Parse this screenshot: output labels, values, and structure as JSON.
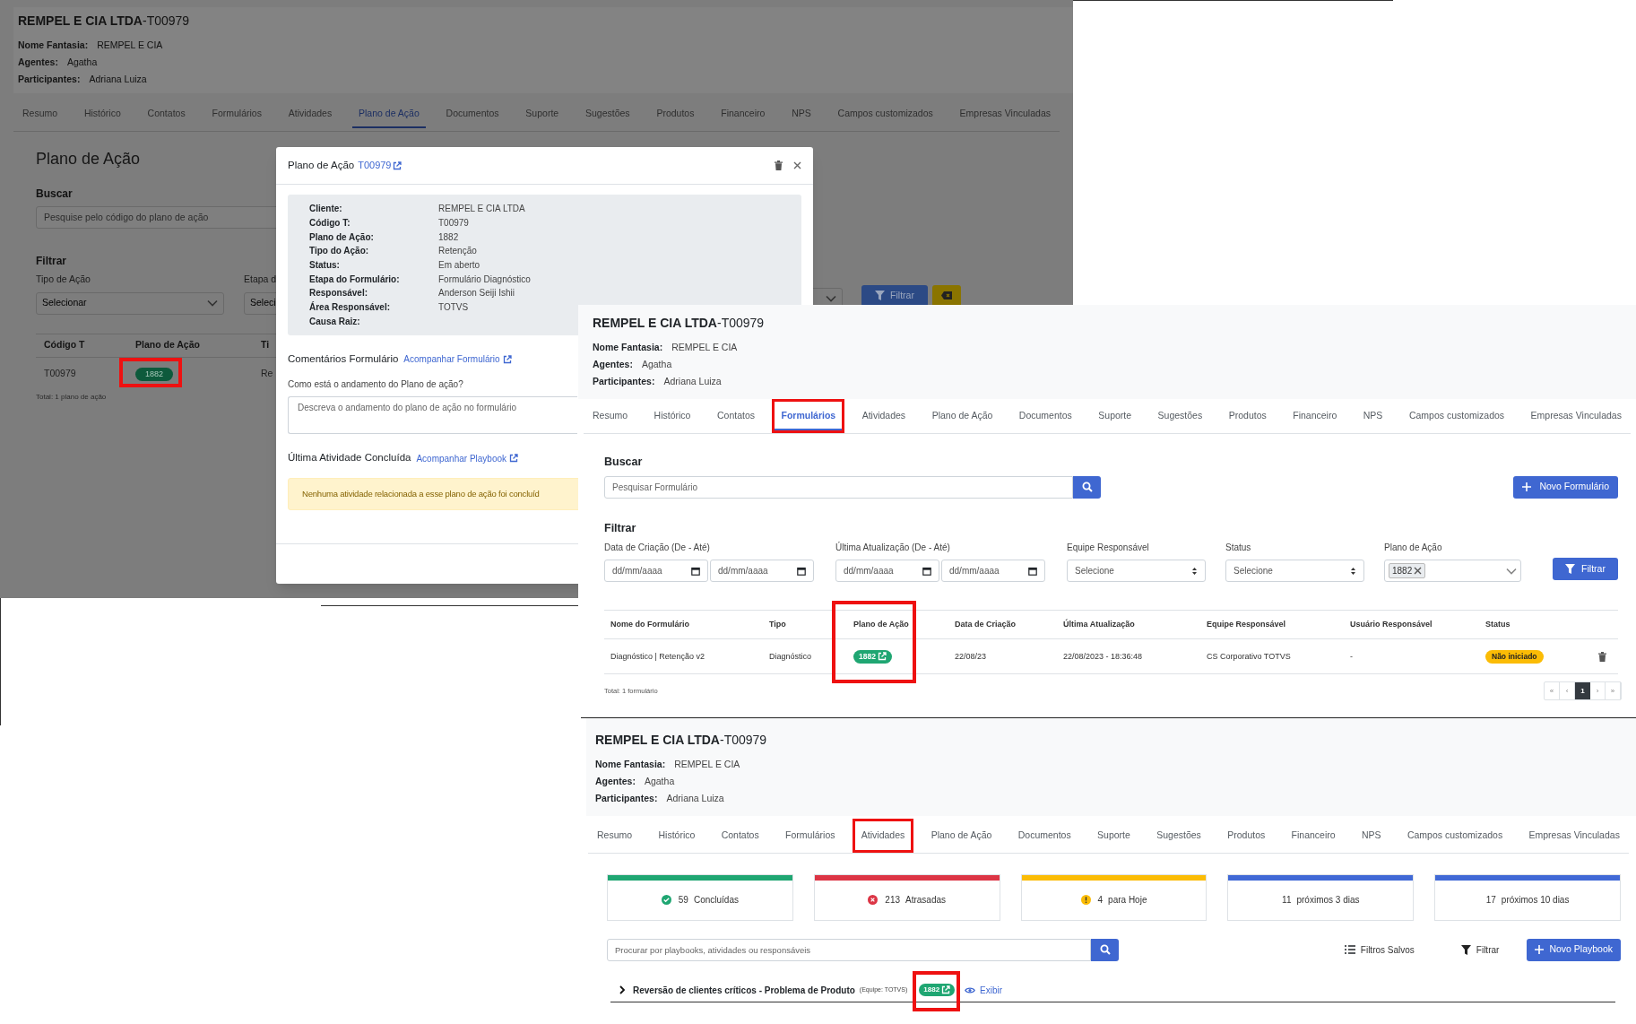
{
  "plan_view": {
    "header": {
      "title": "**REMPEL E CIA LTDA**-T00979",
      "fields": [
        {
          "label": "Nome Fantasia:",
          "value": "REMPEL E CIA"
        },
        {
          "label": "Agentes:",
          "value": "Agatha"
        },
        {
          "label": "Participantes:",
          "value": "Adriana Luiza"
        }
      ]
    },
    "tabs": [
      {
        "label": "Resumo",
        "selected": false,
        "highlighted": false
      },
      {
        "label": "Histórico",
        "selected": false,
        "highlighted": false
      },
      {
        "label": "Contatos",
        "selected": false,
        "highlighted": false
      },
      {
        "label": "Formulários",
        "selected": false,
        "highlighted": false
      },
      {
        "label": "Atividades",
        "selected": false,
        "highlighted": false
      },
      {
        "label": "Plano de Ação",
        "selected": true,
        "highlighted": false
      },
      {
        "label": "Documentos",
        "selected": false,
        "highlighted": false
      },
      {
        "label": "Suporte",
        "selected": false,
        "highlighted": false
      },
      {
        "label": "Sugestões",
        "selected": false,
        "highlighted": false
      },
      {
        "label": "Produtos",
        "selected": false,
        "highlighted": false
      },
      {
        "label": "Financeiro",
        "selected": false,
        "highlighted": false
      },
      {
        "label": "NPS",
        "selected": false,
        "highlighted": false
      },
      {
        "label": "Campos customizados",
        "selected": false,
        "highlighted": false
      },
      {
        "label": "Empresas Vinculadas",
        "selected": false,
        "highlighted": false
      }
    ],
    "page_title": "Plano de Ação",
    "search": {
      "label": "Buscar",
      "placeholder": "Pesquise pelo código do plano de ação"
    },
    "filter": {
      "title": "Filtrar",
      "fields": [
        {
          "label": "Tipo de Ação",
          "value": "Selecionar"
        },
        {
          "label": "Etapa d",
          "value": "Seleci"
        }
      ],
      "button": "Filtrar"
    },
    "table": {
      "columns": [
        "Código T",
        "Plano de Ação",
        "Ti"
      ],
      "rows": [
        {
          "code": "T00979",
          "plan": "1882",
          "highlighted": true,
          "column_3": "Re"
        }
      ],
      "total": "Total: 1 plano de ação"
    },
    "modal": {
      "title": "Plano de Ação",
      "code": "T00979",
      "details": [
        {
          "label": "Cliente:",
          "value": "REMPEL E CIA LTDA"
        },
        {
          "label": "Código T:",
          "value": "T00979"
        },
        {
          "label": "Plano de Ação:",
          "value": "1882"
        },
        {
          "label": "Tipo do Ação:",
          "value": "Retenção"
        },
        {
          "label": "Status:",
          "value": "Em aberto"
        },
        {
          "label": "Etapa do Formulário:",
          "value": "Formulário Diagnóstico"
        },
        {
          "label": "Responsável:",
          "value": "Anderson Seiji Ishii"
        },
        {
          "label": "Área Responsável:",
          "value": "TOTVS"
        },
        {
          "label": "Causa Raiz:"
        }
      ],
      "comments": {
        "title": "Comentários Formulário",
        "link": "Acompanhar Formulário",
        "question": "Como está o andamento do Plano de ação?",
        "placeholder": "Descreva o andamento do plano de ação no formulário"
      },
      "last_activity": {
        "title": "Última Atividade Concluída",
        "link": "Acompanhar Playbook",
        "alert": "Nenhuma atividade relacionada a esse plano de ação foi concluíd"
      }
    }
  },
  "forms_view": {
    "header": {
      "title": "**REMPEL E CIA LTDA**-T00979",
      "fields": [
        {
          "label": "Nome Fantasia:",
          "value": "REMPEL E CIA"
        },
        {
          "label": "Agentes:",
          "value": "Agatha"
        },
        {
          "label": "Participantes:",
          "value": "Adriana Luiza"
        }
      ]
    },
    "tabs": [
      {
        "label": "Resumo",
        "selected": false,
        "highlighted": false
      },
      {
        "label": "Histórico",
        "selected": false,
        "highlighted": false
      },
      {
        "label": "Contatos",
        "selected": false,
        "highlighted": false
      },
      {
        "label": "Formulários",
        "selected": true,
        "highlighted": true
      },
      {
        "label": "Atividades",
        "selected": false,
        "highlighted": false
      },
      {
        "label": "Plano de Ação",
        "selected": false,
        "highlighted": false
      },
      {
        "label": "Documentos",
        "selected": false,
        "highlighted": false
      },
      {
        "label": "Suporte",
        "selected": false,
        "highlighted": false
      },
      {
        "label": "Sugestões",
        "selected": false,
        "highlighted": false
      },
      {
        "label": "Produtos",
        "selected": false,
        "highlighted": false
      },
      {
        "label": "Financeiro",
        "selected": false,
        "highlighted": false
      },
      {
        "label": "NPS",
        "selected": false,
        "highlighted": false
      },
      {
        "label": "Campos customizados",
        "selected": false,
        "highlighted": false
      },
      {
        "label": "Empresas Vinculadas",
        "selected": false,
        "highlighted": false
      }
    ],
    "search": {
      "label": "Buscar",
      "placeholder": "Pesquisar Formulário"
    },
    "new_button": "Novo Formulário",
    "filter": {
      "title": "Filtrar",
      "groups": [
        {
          "kind": "daterange",
          "label": "Data de Criação (De - Até)",
          "placeholders": [
            "dd/mm/aaaa",
            "dd/mm/aaaa"
          ]
        },
        {
          "kind": "daterange",
          "label": "Última Atualização (De - Até)",
          "placeholders": [
            "dd/mm/aaaa",
            "dd/mm/aaaa"
          ]
        },
        {
          "kind": "select",
          "label": "Equipe Responsável",
          "value": "Selecione"
        },
        {
          "kind": "select",
          "label": "Status",
          "value": "Selecione"
        },
        {
          "kind": "tags",
          "label": "Plano de Ação",
          "tags": [
            "1882"
          ]
        }
      ],
      "button": "Filtrar"
    },
    "table": {
      "columns": [
        {
          "label": "Nome do Formulário",
          "highlighted": false
        },
        {
          "label": "Tipo",
          "highlighted": false
        },
        {
          "label": "Plano de Ação",
          "highlighted": true
        },
        {
          "label": "Data de Criação",
          "highlighted": false
        },
        {
          "label": "Última Atualização",
          "highlighted": false
        },
        {
          "label": "Equipe Responsável",
          "highlighted": false
        },
        {
          "label": "Usuário Responsável",
          "highlighted": false
        },
        {
          "label": "Status",
          "highlighted": false
        }
      ],
      "rows": [
        {
          "name": "Diagnóstico | Retenção v2",
          "type": "Diagnóstico",
          "plan": "1882",
          "created": "22/08/23",
          "updated": "22/08/2023 - 18:36:48",
          "team": "CS Corporativo TOTVS",
          "user": "-",
          "status": "Não iniciado"
        }
      ],
      "total": "Total: 1 formulário"
    },
    "pagination": [
      {
        "label": "«",
        "selected": false
      },
      {
        "label": "‹",
        "selected": false
      },
      {
        "label": "1",
        "selected": true
      },
      {
        "label": "›",
        "selected": false
      },
      {
        "label": "»",
        "selected": false
      }
    ]
  },
  "activities_view": {
    "header": {
      "title": "**REMPEL E CIA LTDA**-T00979",
      "fields": [
        {
          "label": "Nome Fantasia:",
          "value": "REMPEL E CIA"
        },
        {
          "label": "Agentes:",
          "value": "Agatha"
        },
        {
          "label": "Participantes:",
          "value": "Adriana Luiza"
        }
      ]
    },
    "tabs": [
      {
        "label": "Resumo",
        "selected": false,
        "highlighted": false
      },
      {
        "label": "Histórico",
        "selected": false,
        "highlighted": false
      },
      {
        "label": "Contatos",
        "selected": false,
        "highlighted": false
      },
      {
        "label": "Formulários",
        "selected": false,
        "highlighted": false
      },
      {
        "label": "Atividades",
        "selected": false,
        "highlighted": true
      },
      {
        "label": "Plano de Ação",
        "selected": false,
        "highlighted": false
      },
      {
        "label": "Documentos",
        "selected": false,
        "highlighted": false
      },
      {
        "label": "Suporte",
        "selected": false,
        "highlighted": false
      },
      {
        "label": "Sugestões",
        "selected": false,
        "highlighted": false
      },
      {
        "label": "Produtos",
        "selected": false,
        "highlighted": false
      },
      {
        "label": "Financeiro",
        "selected": false,
        "highlighted": false
      },
      {
        "label": "NPS",
        "selected": false,
        "highlighted": false
      },
      {
        "label": "Campos customizados",
        "selected": false,
        "highlighted": false
      },
      {
        "label": "Empresas Vinculadas",
        "selected": false,
        "highlighted": false
      }
    ],
    "summary": [
      {
        "kind": "check",
        "count": "59",
        "label": "Concluídas",
        "color": "#1fa672"
      },
      {
        "kind": "cross",
        "count": "213",
        "label": "Atrasadas",
        "color": "#dc3545"
      },
      {
        "kind": "warning",
        "count": "4",
        "label": "para Hoje",
        "color": "#fbbc05"
      },
      {
        "kind": "plain",
        "count": "11",
        "label": "próximos 3 dias",
        "color": "#4169d6"
      },
      {
        "kind": "plain",
        "count": "17",
        "label": "próximos 10 dias",
        "color": "#4169d6"
      }
    ],
    "search": {
      "placeholder": "Procurar por playbooks, atividades ou responsáveis"
    },
    "actions": {
      "saved_filters": "Filtros Salvos",
      "filter": "Filtrar",
      "new_button": "Novo Playbook"
    },
    "playbooks": [
      {
        "title": "Reversão de clientes críticos - Problema de Produto",
        "team": "(Equipe: TOTVS)",
        "plan": "1882",
        "highlighted": true,
        "view_link": "Exibir",
        "expanded": false
      }
    ]
  }
}
